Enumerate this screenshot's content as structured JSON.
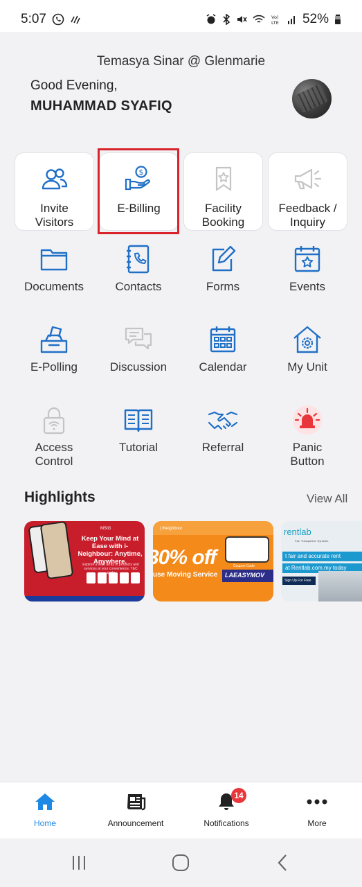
{
  "status_bar": {
    "time": "5:07",
    "battery": "52%",
    "left_icons": [
      "whatsapp-icon",
      "signal-sync-icon"
    ],
    "right_icons": [
      "alarm-icon",
      "bluetooth-icon",
      "mute-icon",
      "wifi-icon",
      "volte-icon",
      "signal-icon",
      "battery-icon"
    ]
  },
  "header": {
    "property": "Temasya Sinar @ Glenmarie",
    "greeting": "Good Evening,",
    "user_name": "MUHAMMAD SYAFIQ"
  },
  "quick_tiles": [
    {
      "label_line1": "Invite",
      "label_line2": "Visitors",
      "icon": "visitors-icon",
      "enabled": true
    },
    {
      "label_line1": "E-Billing",
      "label_line2": "",
      "icon": "billing-icon",
      "enabled": true,
      "highlighted": true
    },
    {
      "label_line1": "Facility",
      "label_line2": "Booking",
      "icon": "bookmark-star-icon",
      "enabled": false
    },
    {
      "label_line1": "Feedback /",
      "label_line2": "Inquiry",
      "icon": "megaphone-icon",
      "enabled": false
    }
  ],
  "menu_items": [
    {
      "label_line1": "Documents",
      "label_line2": "",
      "icon": "folder-icon",
      "enabled": true
    },
    {
      "label_line1": "Contacts",
      "label_line2": "",
      "icon": "phonebook-icon",
      "enabled": true
    },
    {
      "label_line1": "Forms",
      "label_line2": "",
      "icon": "form-edit-icon",
      "enabled": true
    },
    {
      "label_line1": "Events",
      "label_line2": "",
      "icon": "calendar-star-icon",
      "enabled": true
    },
    {
      "label_line1": "E-Polling",
      "label_line2": "",
      "icon": "ballot-box-icon",
      "enabled": true
    },
    {
      "label_line1": "Discussion",
      "label_line2": "",
      "icon": "chat-bubbles-icon",
      "enabled": false
    },
    {
      "label_line1": "Calendar",
      "label_line2": "",
      "icon": "calendar-grid-icon",
      "enabled": true
    },
    {
      "label_line1": "My Unit",
      "label_line2": "",
      "icon": "house-gear-icon",
      "enabled": true
    },
    {
      "label_line1": "Access",
      "label_line2": "Control",
      "icon": "lock-wifi-icon",
      "enabled": false
    },
    {
      "label_line1": "Tutorial",
      "label_line2": "",
      "icon": "open-book-icon",
      "enabled": true
    },
    {
      "label_line1": "Referral",
      "label_line2": "",
      "icon": "handshake-icon",
      "enabled": true
    },
    {
      "label_line1": "Panic",
      "label_line2": "Button",
      "icon": "siren-icon",
      "enabled": true
    }
  ],
  "highlights": {
    "title": "Highlights",
    "view_all": "View All",
    "banners": [
      {
        "logo": "MSIG",
        "headline": "Keep Your Mind at Ease with i-Neighbour: Anytime, Anywhere.",
        "body": "Explore a wide array of products and services at your convenience. T&C apply."
      },
      {
        "brand": "| iNeighbour",
        "headline": "30% off",
        "sub": "use Moving Service",
        "code_label": "Coupon Code",
        "code": "LAEASYMOV"
      },
      {
        "brand": "rentlab",
        "tagline": "Fair. Transparent. Dynamic.",
        "line1": "t fair and accurate rent",
        "line2": "at Rentlab.com.my today",
        "cta": "Sign Up For Free"
      }
    ]
  },
  "bottom_nav": [
    {
      "label": "Home",
      "icon": "home-icon",
      "active": true
    },
    {
      "label": "Announcement",
      "icon": "newspaper-icon",
      "active": false
    },
    {
      "label": "Notifications",
      "icon": "bell-icon",
      "active": false,
      "badge": "14"
    },
    {
      "label": "More",
      "icon": "more-dots-icon",
      "active": false
    }
  ],
  "colors": {
    "accent": "#1e88e5",
    "icon_blue": "#1f6fc7",
    "disabled": "#c4c4c4",
    "highlight_border": "#d8232a",
    "badge": "#e8363a"
  }
}
